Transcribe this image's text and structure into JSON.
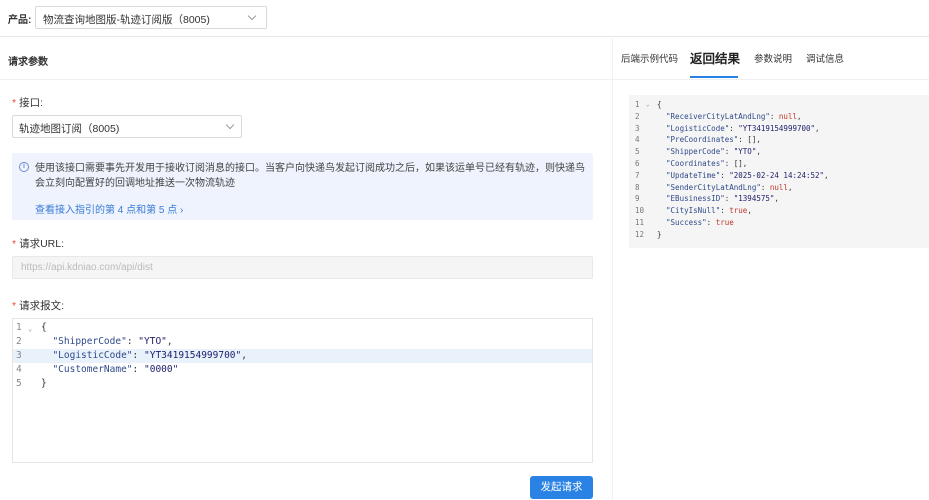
{
  "product": {
    "label": "产品:",
    "selected": "物流查询地图版-轨迹订阅版（8005)"
  },
  "left_panel": {
    "title": "请求参数",
    "api_field": {
      "label": "接口:",
      "selected": "轨迹地图订阅（8005)"
    },
    "info": {
      "text": "使用该接口需要事先开发用于接收订阅消息的接口。当客户向快递鸟发起订阅成功之后，如果该运单号已经有轨迹，则快递鸟会立刻向配置好的回调地址推送一次物流轨迹",
      "link": "查看接入指引的第 4 点和第 5 点 ›"
    },
    "url_field": {
      "label": "请求URL:",
      "placeholder": "https://api.kdniao.com/api/dist"
    },
    "body_field": {
      "label": "请求报文:",
      "lines": [
        {
          "n": "1",
          "fold": "⌄",
          "code": "{"
        },
        {
          "n": "2",
          "code": "  \"ShipperCode\": \"YTO\","
        },
        {
          "n": "3",
          "code": "  \"LogisticCode\": \"YT3419154999700\","
        },
        {
          "n": "4",
          "code": "  \"CustomerName\": \"0000\""
        },
        {
          "n": "5",
          "code": "}"
        }
      ]
    },
    "submit_label": "发起请求"
  },
  "tabs": [
    {
      "label": "后端示例代码",
      "active": false
    },
    {
      "label": "返回结果",
      "active": true
    },
    {
      "label": "参数说明",
      "active": false
    },
    {
      "label": "调试信息",
      "active": false
    }
  ],
  "result": {
    "lines": [
      {
        "n": "1",
        "fold": "⌄",
        "code": "{"
      },
      {
        "n": "2",
        "code": "  \"ReceiverCityLatAndLng\": null,"
      },
      {
        "n": "3",
        "code": "  \"LogisticCode\": \"YT3419154999700\","
      },
      {
        "n": "4",
        "code": "  \"PreCoordinates\": [],"
      },
      {
        "n": "5",
        "code": "  \"ShipperCode\": \"YTO\","
      },
      {
        "n": "6",
        "code": "  \"Coordinates\": [],"
      },
      {
        "n": "7",
        "code": "  \"UpdateTime\": \"2025-02-24 14:24:52\","
      },
      {
        "n": "8",
        "code": "  \"SenderCityLatAndLng\": null,"
      },
      {
        "n": "9",
        "code": "  \"EBusinessID\": \"1394575\","
      },
      {
        "n": "10",
        "code": "  \"CityIsNull\": true,"
      },
      {
        "n": "11",
        "code": "  \"Success\": true"
      },
      {
        "n": "12",
        "code": "}"
      }
    ]
  },
  "colors": {
    "accent": "#2a82e4",
    "required": "#e74c3c",
    "info_bg": "#eef3fd",
    "link": "#3a7bd5"
  }
}
